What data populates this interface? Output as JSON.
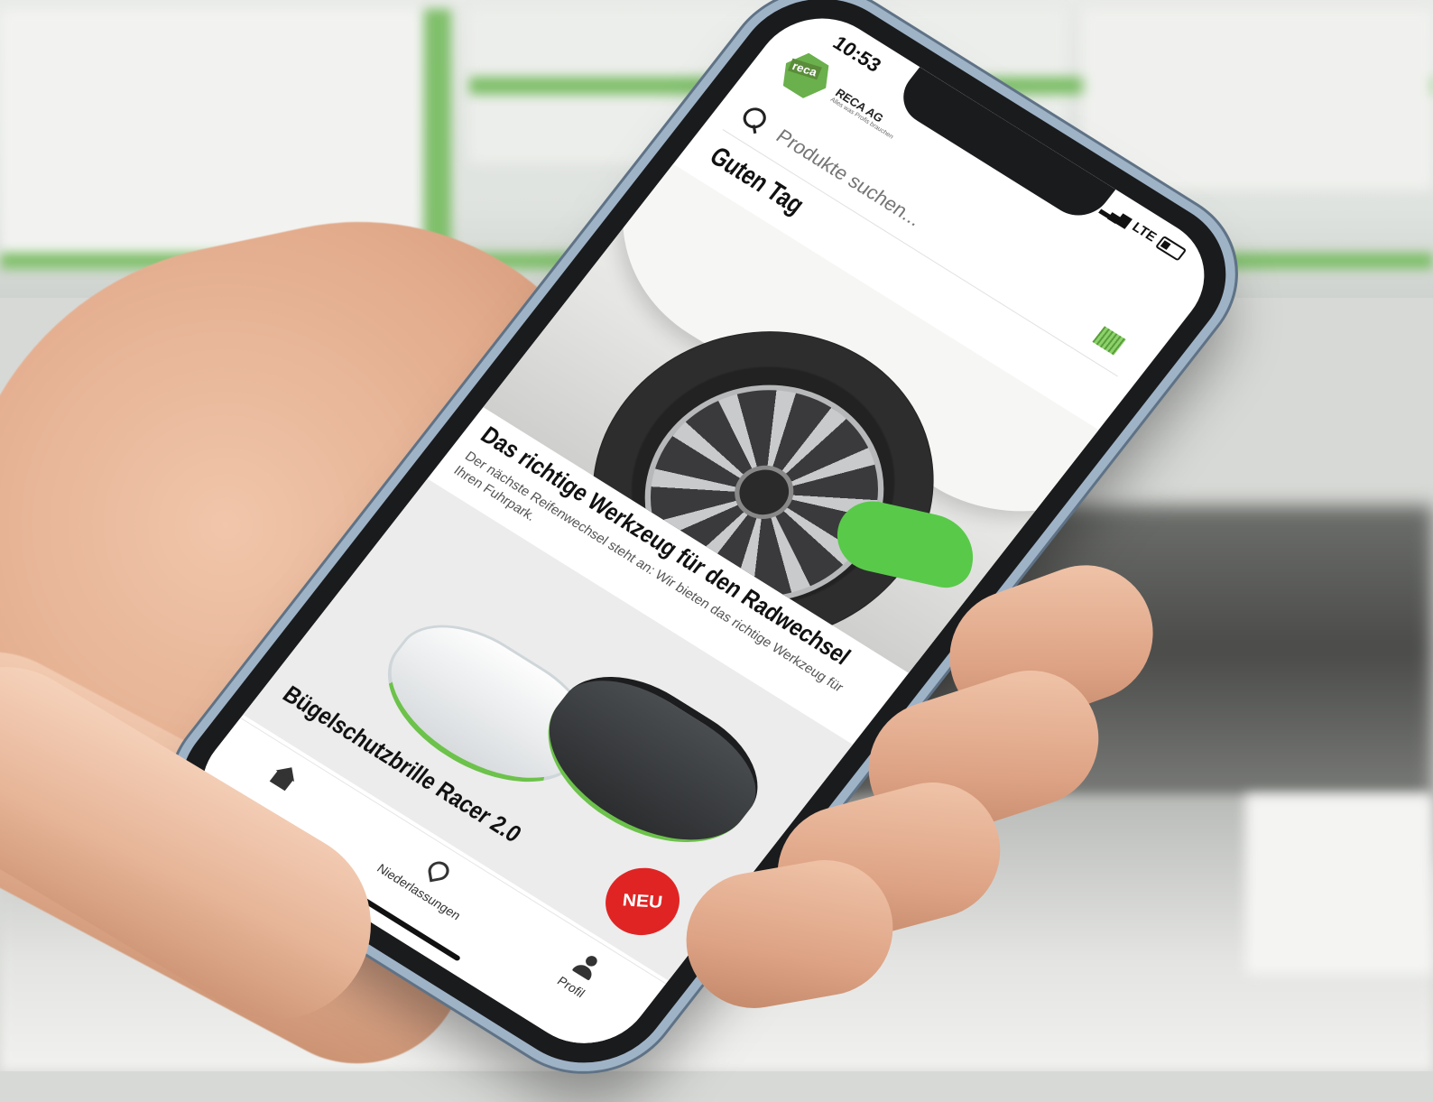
{
  "status_bar": {
    "time": "10:53",
    "network": "LTE"
  },
  "brand": {
    "logo_text": "reca",
    "name": "RECA AG",
    "tagline": "Alles was Profis brauchen"
  },
  "search": {
    "placeholder": "Produkte suchen..."
  },
  "greeting": "Guten Tag",
  "article": {
    "title": "Das richtige Werkzeug für den Radwechsel",
    "text": "Der nächste Reifenwechsel steht an: Wir bieten das richtige Werkzeug für Ihren Fuhrpark."
  },
  "product": {
    "name": "Bügelschutzbrille Racer 2.0",
    "badge": "NEU"
  },
  "tabbar": {
    "items": [
      {
        "label": "",
        "icon": "home-icon"
      },
      {
        "label": "Niederlassungen",
        "icon": "location-pin-icon"
      },
      {
        "label": "Profil",
        "icon": "person-icon"
      }
    ]
  },
  "colors": {
    "brand_green": "#6ab04c",
    "badge_red": "#e02424"
  }
}
